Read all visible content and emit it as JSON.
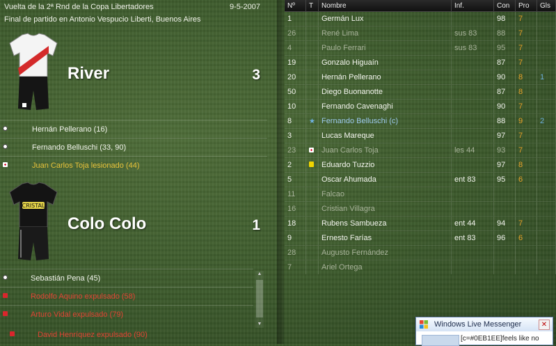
{
  "match": {
    "title": "Vuelta de la 2ª Rnd de la Copa Libertadores",
    "date": "9-5-2007",
    "venue": "Final de partido en Antonio Vespucio Liberti, Buenos Aires"
  },
  "home": {
    "name": "River",
    "score": "3",
    "events": [
      {
        "icon": "ball-icon",
        "text": "Hernán Pellerano (16)",
        "style": "normal"
      },
      {
        "icon": "ball-icon",
        "text": "Fernando Belluschi (33, 90)",
        "style": "normal"
      },
      {
        "icon": "injury-icon",
        "text": "Juan Carlos Toja lesionado (44)",
        "style": "yellow"
      }
    ]
  },
  "away": {
    "name": "Colo Colo",
    "score": "1",
    "sponsor": "CRISTAL",
    "events": [
      {
        "icon": "ball-icon",
        "text": "Sebastián Pena (45)",
        "style": "normal"
      },
      {
        "icon": "red-card-icon",
        "text": "Rodolfo Aquino expulsado (58)",
        "style": "red"
      },
      {
        "icon": "red-card-icon",
        "text": "Arturo Vidal expulsado (79)",
        "style": "red"
      },
      {
        "icon": "red-card-icon",
        "text": "David Henríquez expulsado (90)",
        "style": "red"
      }
    ]
  },
  "squad": {
    "headers": [
      "Nº",
      "T",
      "Nombre",
      "Inf.",
      "Con",
      "Pro",
      "Gls"
    ],
    "rows": [
      {
        "num": "1",
        "t": "",
        "name": "Germán Lux",
        "inf": "",
        "con": "98",
        "pro": "7",
        "gls": "",
        "dim": false
      },
      {
        "num": "26",
        "t": "",
        "name": "René Lima",
        "inf": "sus 83",
        "con": "88",
        "pro": "7",
        "gls": "",
        "dim": true
      },
      {
        "num": "4",
        "t": "",
        "name": "Paulo Ferrari",
        "inf": "sus 83",
        "con": "95",
        "pro": "7",
        "gls": "",
        "dim": true
      },
      {
        "num": "19",
        "t": "",
        "name": "Gonzalo Higuaín",
        "inf": "",
        "con": "87",
        "pro": "7",
        "gls": "",
        "dim": false
      },
      {
        "num": "20",
        "t": "",
        "name": "Hernán Pellerano",
        "inf": "",
        "con": "90",
        "pro": "8",
        "gls": "1",
        "dim": false
      },
      {
        "num": "50",
        "t": "",
        "name": "Diego Buonanotte",
        "inf": "",
        "con": "87",
        "pro": "8",
        "gls": "",
        "dim": false
      },
      {
        "num": "10",
        "t": "",
        "name": "Fernando Cavenaghi",
        "inf": "",
        "con": "90",
        "pro": "7",
        "gls": "",
        "dim": false
      },
      {
        "num": "8",
        "t": "star",
        "name": "Fernando Belluschi (c)",
        "inf": "",
        "con": "88",
        "pro": "9",
        "gls": "2",
        "dim": false,
        "highlight": true
      },
      {
        "num": "3",
        "t": "",
        "name": "Lucas Mareque",
        "inf": "",
        "con": "97",
        "pro": "7",
        "gls": "",
        "dim": false
      },
      {
        "num": "23",
        "t": "injury",
        "name": "Juan Carlos Toja",
        "inf": "les 44",
        "con": "93",
        "pro": "7",
        "gls": "",
        "dim": true
      },
      {
        "num": "2",
        "t": "yellow",
        "name": "Eduardo Tuzzio",
        "inf": "",
        "con": "97",
        "pro": "8",
        "gls": "",
        "dim": false
      },
      {
        "num": "5",
        "t": "",
        "name": "Oscar Ahumada",
        "inf": "ent 83",
        "con": "95",
        "pro": "6",
        "gls": "",
        "dim": false
      },
      {
        "num": "11",
        "t": "",
        "name": "Falcao",
        "inf": "",
        "con": "",
        "pro": "",
        "gls": "",
        "dim": true
      },
      {
        "num": "16",
        "t": "",
        "name": "Cristian Villagra",
        "inf": "",
        "con": "",
        "pro": "",
        "gls": "",
        "dim": true
      },
      {
        "num": "18",
        "t": "",
        "name": "Rubens Sambueza",
        "inf": "ent 44",
        "con": "94",
        "pro": "7",
        "gls": "",
        "dim": false
      },
      {
        "num": "9",
        "t": "",
        "name": "Ernesto Farías",
        "inf": "ent 83",
        "con": "96",
        "pro": "6",
        "gls": "",
        "dim": false
      },
      {
        "num": "28",
        "t": "",
        "name": "Augusto Fernández",
        "inf": "",
        "con": "",
        "pro": "",
        "gls": "",
        "dim": true
      },
      {
        "num": "7",
        "t": "",
        "name": "Ariel Ortega",
        "inf": "",
        "con": "",
        "pro": "",
        "gls": "",
        "dim": true
      }
    ]
  },
  "messenger": {
    "title": "Windows Live Messenger",
    "message": "[c=#0EB1EE]feels like no",
    "close_glyph": "✕"
  },
  "scrollbar": {
    "up_glyph": "▲",
    "down_glyph": "▼"
  }
}
